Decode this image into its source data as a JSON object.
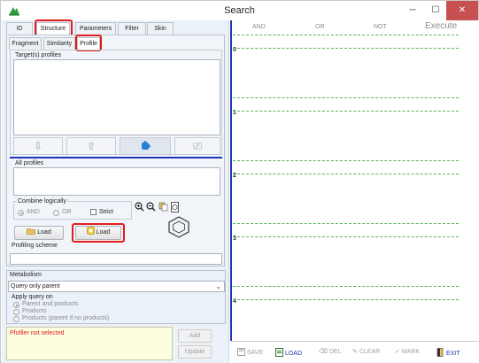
{
  "window": {
    "title": "Search",
    "min_label": "─",
    "max_label": "☐",
    "close_label": "✕"
  },
  "main_tabs": [
    {
      "label": "ID"
    },
    {
      "label": "Structure"
    },
    {
      "label": "Parameters"
    },
    {
      "label": "Filter"
    },
    {
      "label": "Skin"
    }
  ],
  "sub_tabs": [
    {
      "label": "Fragment"
    },
    {
      "label": "Similarity"
    },
    {
      "label": "Profile"
    }
  ],
  "profile": {
    "targets_label": "Target(s) profiles",
    "all_profiles_label": "All profiles",
    "combine_label": "Combine logically",
    "and_label": "AND",
    "or_label": "OR",
    "strict_label": "Strict",
    "load1_label": "Load",
    "load2_label": "Load",
    "scheme_label": "Profiling scheme"
  },
  "metabolism": {
    "label": "Metabolism",
    "select_value": "Query only parent",
    "apply_label": "Apply query on",
    "options": [
      "Parent and products",
      "Products",
      "Products (parent if no products)"
    ]
  },
  "status": {
    "message": "Pfofiler not selected",
    "add_label": "Add",
    "update_label": "Update"
  },
  "query_area": {
    "headers": [
      "AND",
      "OR",
      "NOT"
    ],
    "execute_label": "Execute",
    "rows": [
      "0",
      "1",
      "2",
      "3",
      "4"
    ]
  },
  "bottom_toolbar": {
    "save": "SAVE",
    "load": "LOAD",
    "del": "DEL",
    "clear": "CLEAR",
    "mark": "MARK",
    "exit": "EXIT"
  },
  "colors": {
    "accent_blue": "#1f35b5",
    "highlight_red": "#e01d1d",
    "dash_green": "#5ab15a",
    "status_red": "#e01d1d"
  }
}
